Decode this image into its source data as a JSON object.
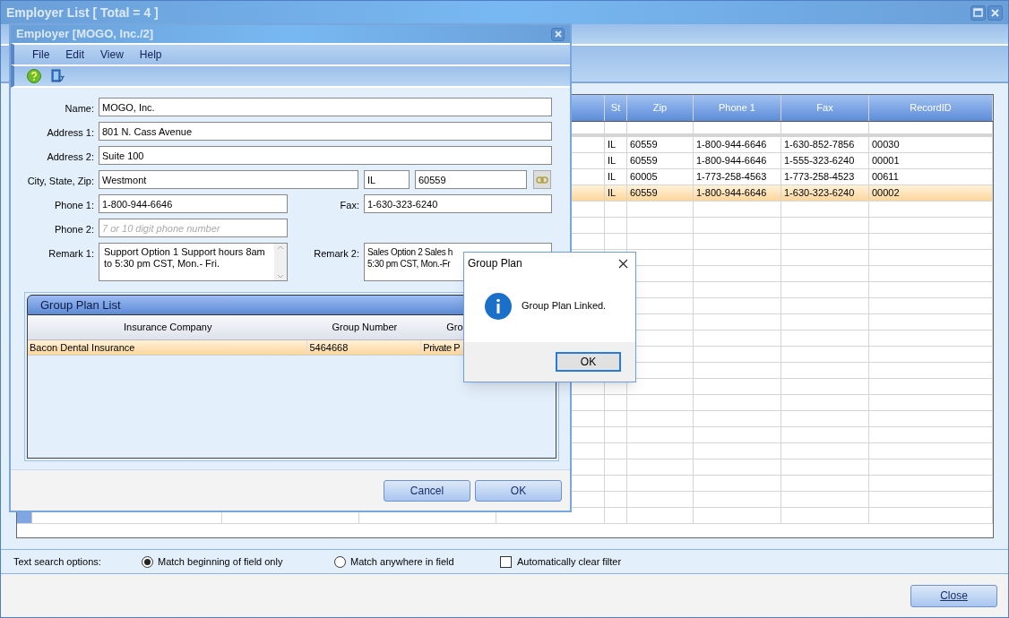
{
  "window": {
    "title": "Employer List [ Total = 4 ]"
  },
  "grid": {
    "columns": [
      "St",
      "Zip",
      "Phone 1",
      "Fax",
      "RecordID"
    ],
    "rows": [
      {
        "cells": [
          "IL",
          "60559",
          "1-800-944-6646",
          "1-630-852-7856",
          "00030"
        ],
        "selected": false
      },
      {
        "cells": [
          "IL",
          "60559",
          "1-800-944-6646",
          "1-555-323-6240",
          "00001"
        ],
        "selected": false
      },
      {
        "cells": [
          "IL",
          "60005",
          "1-773-258-4563",
          "1-773-258-4523",
          "00611"
        ],
        "selected": false
      },
      {
        "cells": [
          "IL",
          "60559",
          "1-800-944-6646",
          "1-630-323-6240",
          "00002"
        ],
        "selected": true
      }
    ]
  },
  "search_options": {
    "label": "Text search options:",
    "options": [
      {
        "label": "Match beginning of field only",
        "selected": true
      },
      {
        "label": "Match anywhere in field",
        "selected": false
      }
    ],
    "checkbox": {
      "label": "Automatically clear filter",
      "checked": false
    }
  },
  "close_button": "Close",
  "employer_dialog": {
    "title": "Employer [MOGO, Inc./2]",
    "menu": [
      "File",
      "Edit",
      "View",
      "Help"
    ],
    "fields": {
      "name": {
        "label": "Name:",
        "value": "MOGO, Inc."
      },
      "address1": {
        "label": "Address 1:",
        "value": "801 N. Cass Avenue"
      },
      "address2": {
        "label": "Address 2:",
        "value": "Suite 100"
      },
      "city_state_zip": {
        "label": "City, State, Zip:",
        "city": "Westmont",
        "state": "IL",
        "zip": "60559"
      },
      "phone1": {
        "label": "Phone 1:",
        "value": "1-800-944-6646"
      },
      "fax": {
        "label": "Fax:",
        "value": "1-630-323-6240"
      },
      "phone2": {
        "label": "Phone 2:",
        "placeholder": "7 or 10 digit phone number"
      },
      "remark1": {
        "label": "Remark 1:",
        "value": "Support Option 1  Support hours 8am to 5:30 pm CST, Mon.- Fri."
      },
      "remark2": {
        "label": "Remark 2:",
        "lines": [
          "Sales Option 2 Sales h",
          "5:30 pm CST, Mon.-Fr"
        ]
      }
    },
    "group_plan_list": {
      "title": "Group Plan List",
      "columns": [
        "Insurance Company",
        "Group Number",
        "Gro"
      ],
      "rows": [
        {
          "cells": [
            "Bacon Dental Insurance",
            "5464668",
            "Private P"
          ],
          "selected": true
        }
      ]
    },
    "buttons": [
      "Cancel",
      "OK"
    ]
  },
  "message_box": {
    "title": "Group Plan",
    "message": "Group Plan Linked.",
    "button": "OK"
  }
}
